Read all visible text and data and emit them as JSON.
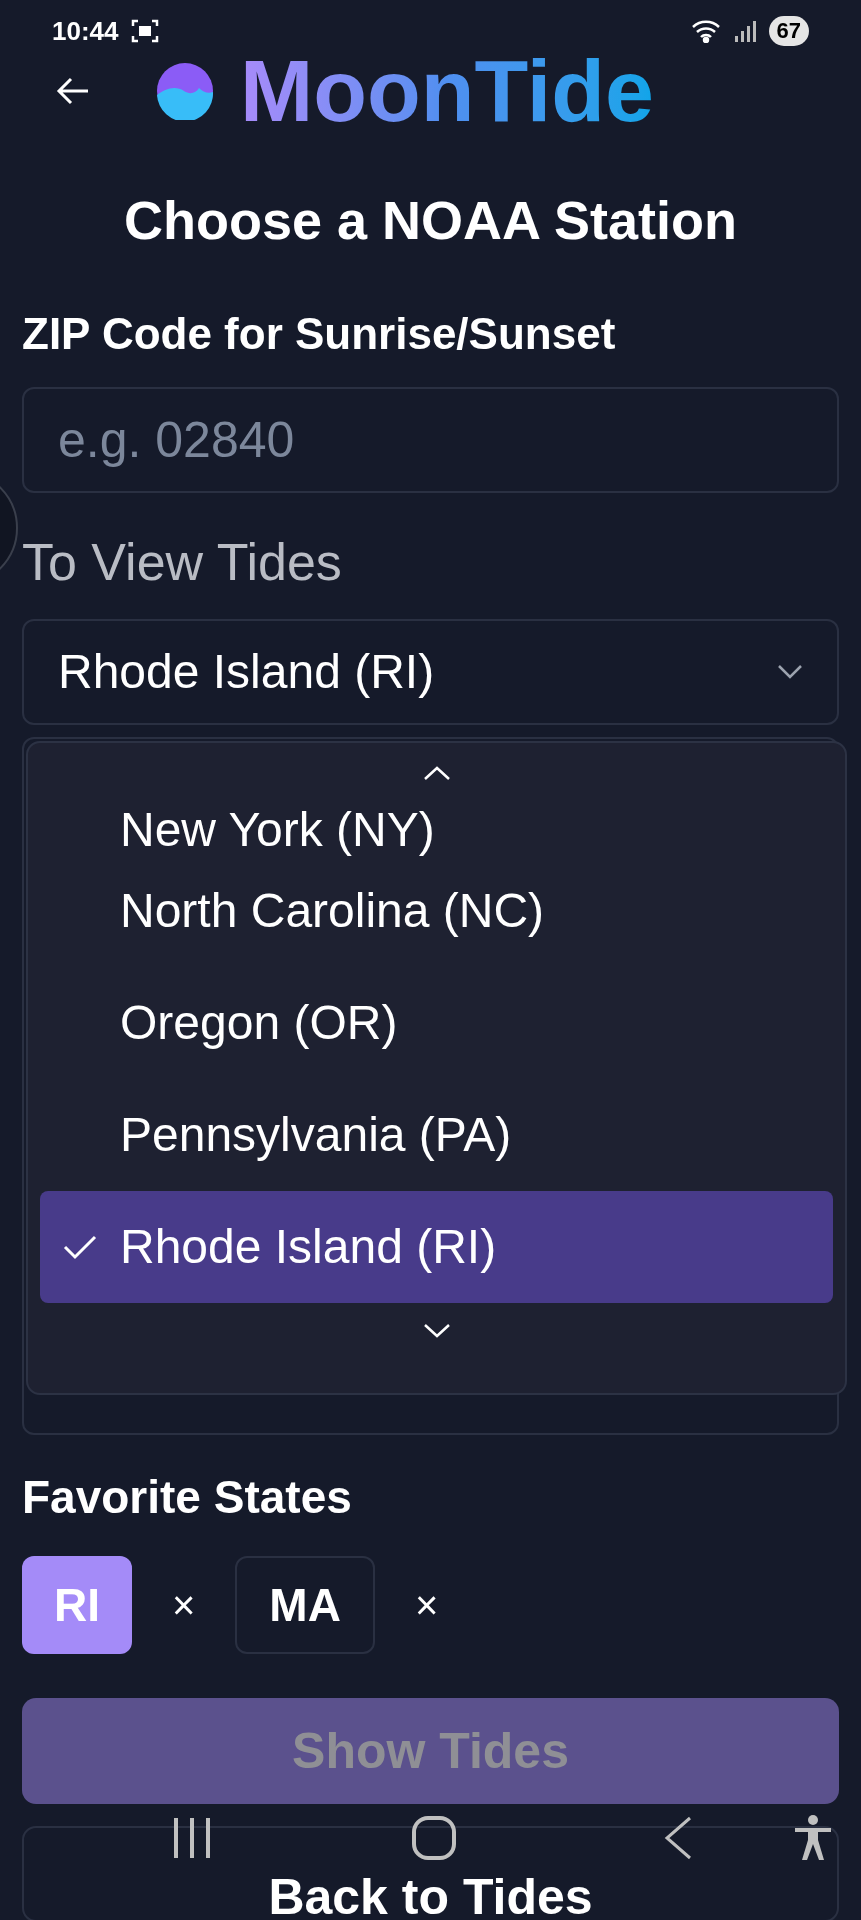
{
  "status_bar": {
    "time": "10:44",
    "battery": "67"
  },
  "header": {
    "app_name": "MoonTide"
  },
  "title": "Choose a NOAA Station",
  "zip": {
    "label": "ZIP Code for Sunrise/Sunset",
    "placeholder": "e.g. 02840"
  },
  "state_select": {
    "label": "To View Tides",
    "value": "Rhode Island (RI)"
  },
  "dropdown": {
    "options": [
      {
        "label": "New York (NY)",
        "selected": false
      },
      {
        "label": "North Carolina (NC)",
        "selected": false
      },
      {
        "label": "Oregon (OR)",
        "selected": false
      },
      {
        "label": "Pennsylvania (PA)",
        "selected": false
      },
      {
        "label": "Rhode Island (RI)",
        "selected": true
      }
    ]
  },
  "favorites": {
    "label": "Favorite States",
    "items": [
      {
        "label": "RI",
        "selected": true,
        "remove": "×"
      },
      {
        "label": "MA",
        "selected": false,
        "remove": "×"
      }
    ]
  },
  "buttons": [
    {
      "label": "Show Tides",
      "kind": "primary",
      "disabled": true
    },
    {
      "label": "Back to Tides",
      "kind": "outline",
      "disabled": false
    }
  ]
}
